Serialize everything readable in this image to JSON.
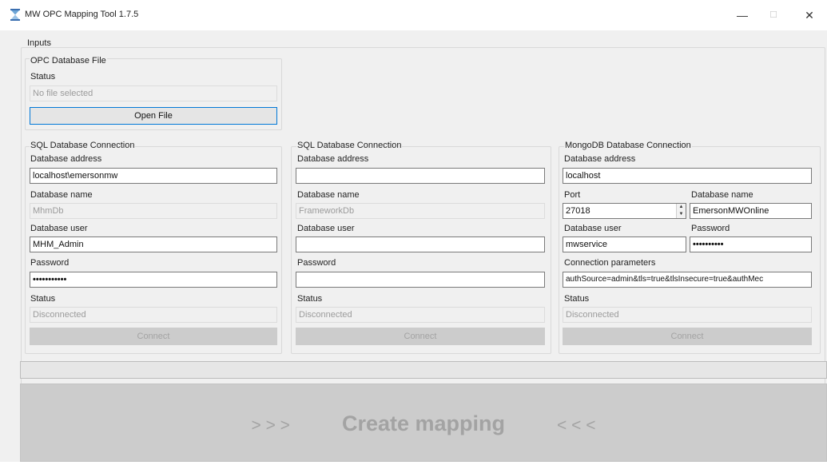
{
  "window": {
    "title": "MW OPC Mapping Tool 1.7.5",
    "controls": {
      "minimize": "—",
      "maximize": "☐",
      "close": "✕"
    }
  },
  "inputs_label": "Inputs",
  "opc": {
    "group_label": "OPC Database File",
    "status_label": "Status",
    "status_value": "No file selected",
    "open_button": "Open File"
  },
  "sql1": {
    "group_label": "SQL Database Connection",
    "address_label": "Database address",
    "address_value": "localhost\\emersonmw",
    "name_label": "Database name",
    "name_value": "MhmDb",
    "user_label": "Database user",
    "user_value": "MHM_Admin",
    "password_label": "Password",
    "password_value": "•••••••••••",
    "status_label": "Status",
    "status_value": "Disconnected",
    "connect_button": "Connect"
  },
  "sql2": {
    "group_label": "SQL Database Connection",
    "address_label": "Database address",
    "address_value": "",
    "name_label": "Database name",
    "name_value": "FrameworkDb",
    "user_label": "Database user",
    "user_value": "",
    "password_label": "Password",
    "password_value": "",
    "status_label": "Status",
    "status_value": "Disconnected",
    "connect_button": "Connect"
  },
  "mongo": {
    "group_label": "MongoDB Database Connection",
    "address_label": "Database address",
    "address_value": "localhost",
    "port_label": "Port",
    "port_value": "27018",
    "name_label": "Database name",
    "name_value": "EmersonMWOnline",
    "user_label": "Database user",
    "user_value": "mwservice",
    "password_label": "Password",
    "password_value": "••••••••••",
    "params_label": "Connection parameters",
    "params_value": "authSource=admin&tls=true&tlsInsecure=true&authMec",
    "status_label": "Status",
    "status_value": "Disconnected",
    "connect_button": "Connect"
  },
  "create_mapping": {
    "left_arrows": "> > >",
    "label": "Create mapping",
    "right_arrows": "< < <"
  },
  "colors": {
    "focus_border": "#0078d7",
    "disabled_bg": "#cccccc",
    "disabled_text": "#a3a3a3",
    "window_bg": "#f0f0f0"
  }
}
